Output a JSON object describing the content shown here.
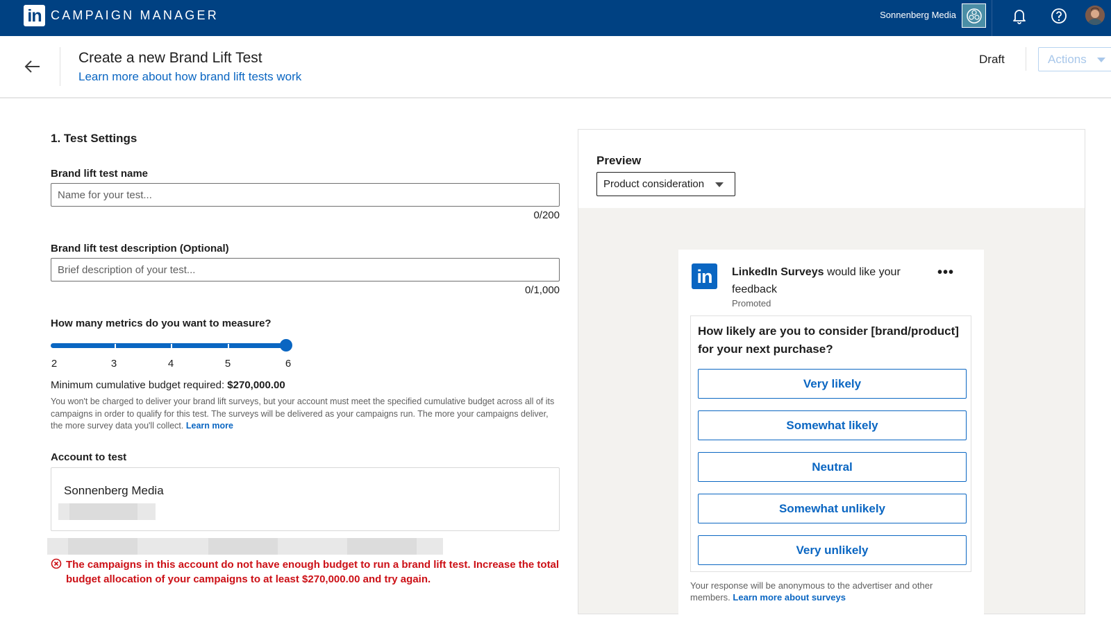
{
  "app": {
    "title": "CAMPAIGN MANAGER",
    "logo_text": "in"
  },
  "account": {
    "name": "Sonnenberg Media"
  },
  "header": {
    "page_title": "Create a new Brand Lift Test",
    "learn_link": "Learn more about how brand lift tests work",
    "status": "Draft",
    "actions_label": "Actions"
  },
  "form": {
    "section_title": "1. Test Settings",
    "name": {
      "label": "Brand lift test name",
      "placeholder": "Name for your test...",
      "value": "",
      "counter": "0/200"
    },
    "description": {
      "label": "Brand lift test description (Optional)",
      "placeholder": "Brief description of your test...",
      "value": "",
      "counter": "0/1,000"
    },
    "metrics": {
      "label": "How many metrics do you want to measure?",
      "options": [
        "2",
        "3",
        "4",
        "5",
        "6"
      ],
      "selected": 6
    },
    "budget": {
      "label": "Minimum cumulative budget required:",
      "amount": "$270,000.00",
      "help": "You won't be charged to deliver your brand lift surveys, but your account must meet the specified cumulative budget across all of its campaigns in order to qualify for this test. The surveys will be delivered as your campaigns run. The more your campaigns deliver, the more survey data you'll collect.",
      "learn_more": "Learn more"
    },
    "account_to_test": {
      "label": "Account to test",
      "name": "Sonnenberg Media"
    },
    "error": "The campaigns in this account do not have enough budget to run a brand lift test. Increase the total budget allocation of your campaigns to at least $270,000.00 and try again."
  },
  "preview": {
    "title": "Preview",
    "selected_view": "Product consideration",
    "survey": {
      "logo_text": "in",
      "sponsor_name": "LinkedIn Surveys",
      "sponsor_suffix": " would like your feedback",
      "promoted": "Promoted",
      "more": "•••",
      "question": "How likely are you to consider [brand/product] for your next purchase?",
      "answers": [
        "Very likely",
        "Somewhat likely",
        "Neutral",
        "Somewhat unlikely",
        "Very unlikely"
      ],
      "footer": "Your response will be anonymous to the advertiser and other members.",
      "footer_link": "Learn more about surveys"
    }
  },
  "colors": {
    "topbar": "#004182",
    "accent": "#0a66c2",
    "error": "#cc1016"
  }
}
